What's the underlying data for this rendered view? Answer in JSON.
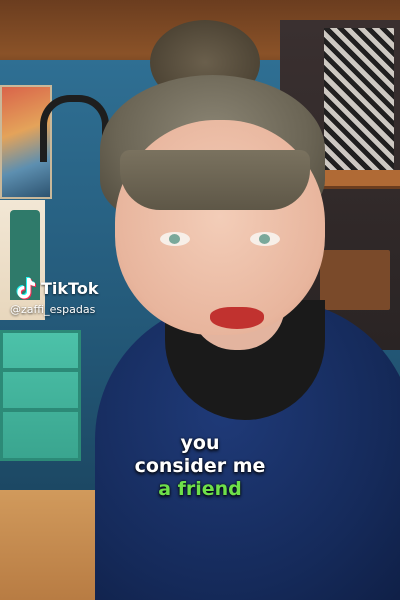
{
  "watermark": {
    "brand": "TikTok",
    "username": "@zaffi_espadas",
    "icon": "tiktok-logo-icon"
  },
  "captions": {
    "lines": [
      {
        "text": "you",
        "highlight": false
      },
      {
        "text": "consider me",
        "highlight": false
      },
      {
        "text": "a friend",
        "highlight": true
      }
    ]
  },
  "colors": {
    "caption_text": "#ffffff",
    "caption_highlight": "#6ee04a"
  }
}
